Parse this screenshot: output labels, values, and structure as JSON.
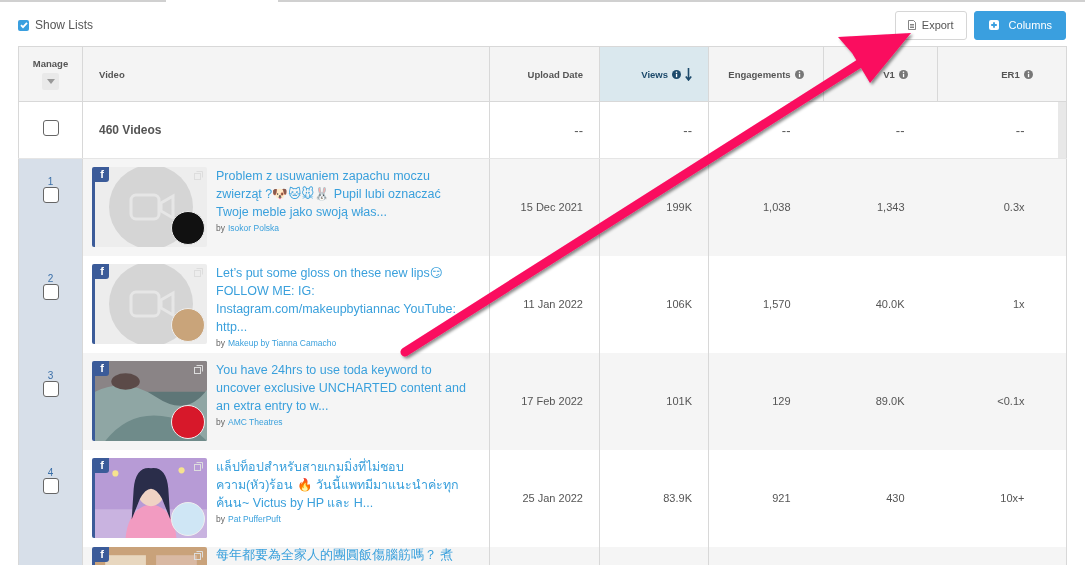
{
  "show_lists": {
    "label": "Show Lists",
    "checked": true
  },
  "toolbar": {
    "export": "Export",
    "columns": "Columns"
  },
  "table": {
    "columns": [
      {
        "label": "Manage",
        "kind": "manage",
        "sorted": false,
        "info": false
      },
      {
        "label": "Video",
        "kind": "text",
        "sorted": false,
        "info": false
      },
      {
        "label": "Upload Date",
        "kind": "num",
        "sorted": false,
        "info": false
      },
      {
        "label": "Views",
        "kind": "num",
        "sorted": true,
        "info": true
      },
      {
        "label": "Engagements",
        "kind": "num",
        "sorted": false,
        "info": true
      },
      {
        "label": "V1",
        "kind": "num",
        "sorted": false,
        "info": true
      },
      {
        "label": "ER1",
        "kind": "num",
        "sorted": false,
        "info": true
      }
    ],
    "total": {
      "checked": false,
      "label": "460 Videos",
      "values": [
        "--",
        "--",
        "--",
        "--",
        "--"
      ]
    },
    "rows": [
      {
        "number": "1",
        "checked": false,
        "platform": "f",
        "kind": "placeholder",
        "title": "Problem z usuwaniem zapachu moczu zwierząt ?🐶🐱🐭🐰 Pupil lubi oznaczać Twoje meble jako swoją włas...",
        "by": "by",
        "author": "Isokor Polska",
        "values": [
          "15 Dec 2021",
          "199K",
          "1,038",
          "1,343",
          "0.3x"
        ]
      },
      {
        "number": "2",
        "checked": false,
        "platform": "f",
        "kind": "placeholder",
        "title": "Let’s put some gloss on these new lips😏 FOLLOW ME: IG: Instagram.com/makeupbytiannac YouTube: http...",
        "by": "by",
        "author": "Makeup by Tianna Camacho",
        "values": [
          "11 Jan 2022",
          "106K",
          "1,570",
          "40.0K",
          "1x"
        ]
      },
      {
        "number": "3",
        "checked": false,
        "platform": "f",
        "kind": "picture",
        "title": "You have 24hrs to use toda keyword to uncover exclusive UNCHARTED content and an extra entry to w...",
        "by": "by",
        "author": "AMC Theatres",
        "values": [
          "17 Feb 2022",
          "101K",
          "129",
          "89.0K",
          "<0.1x"
        ]
      },
      {
        "number": "4",
        "checked": false,
        "platform": "f",
        "kind": "picture",
        "title": "แล็ปท็อปสำหรับสายเกมมิ่งที่ไม่ชอบความ(หัว)ร้อน 🔥 วันนี้แพทมีมาแนะนำค่ะทุกค้นน~ Victus by HP และ H...",
        "by": "by",
        "author": "Pat PufferPuft",
        "values": [
          "25 Jan 2022",
          "83.9K",
          "921",
          "430",
          "10x+"
        ]
      },
      {
        "platform": "f",
        "kind": "picture",
        "title": "每年都要為全家人的團圓飯傷腦筋嗎？ 煮"
      }
    ]
  },
  "annotation": {
    "kind": "arrow"
  }
}
